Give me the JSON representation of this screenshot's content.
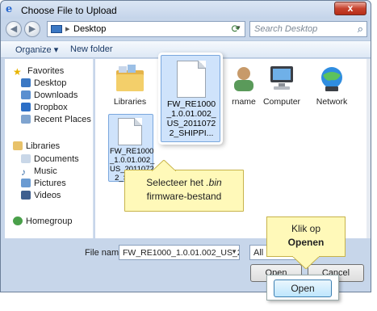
{
  "window": {
    "title": "Choose File to Upload",
    "close_glyph": "x"
  },
  "navbar": {
    "back_icon": "back-arrow-icon",
    "forward_icon": "forward-arrow-icon",
    "location": "Desktop",
    "search_placeholder": "Search Desktop"
  },
  "toolbar": {
    "organize": "Organize ▾",
    "new_folder": "New folder"
  },
  "navpane": {
    "favorites": "Favorites",
    "fav_items": [
      "Desktop",
      "Downloads",
      "Dropbox",
      "Recent Places"
    ],
    "libraries": "Libraries",
    "lib_items": [
      "Documents",
      "Music",
      "Pictures",
      "Videos"
    ],
    "homegroup": "Homegroup"
  },
  "content": {
    "items": [
      "Libraries",
      "rname",
      "Computer",
      "Network"
    ],
    "file_large": "FW_RE1000\n_1.0.01.002_\nUS_2011072\n2_SHIPPI...",
    "file_small": "FW_RE1000\n_1.0.01.002_\nUS_2011072\n2_SHIPPI"
  },
  "callouts": {
    "file_line1_a": "Selecteer het ",
    "file_line1_b": ".bin",
    "file_line2": "firmware-bestand",
    "open_line1": "Klik  op",
    "open_line2": "Openen"
  },
  "bottom": {
    "filename_label": "File name:",
    "filename_value": "FW_RE1000_1.0.01.002_US_2011072",
    "filter_value": "All F",
    "open_button": "Open",
    "cancel_button": "Cancel",
    "zoomed_open": "Open"
  }
}
